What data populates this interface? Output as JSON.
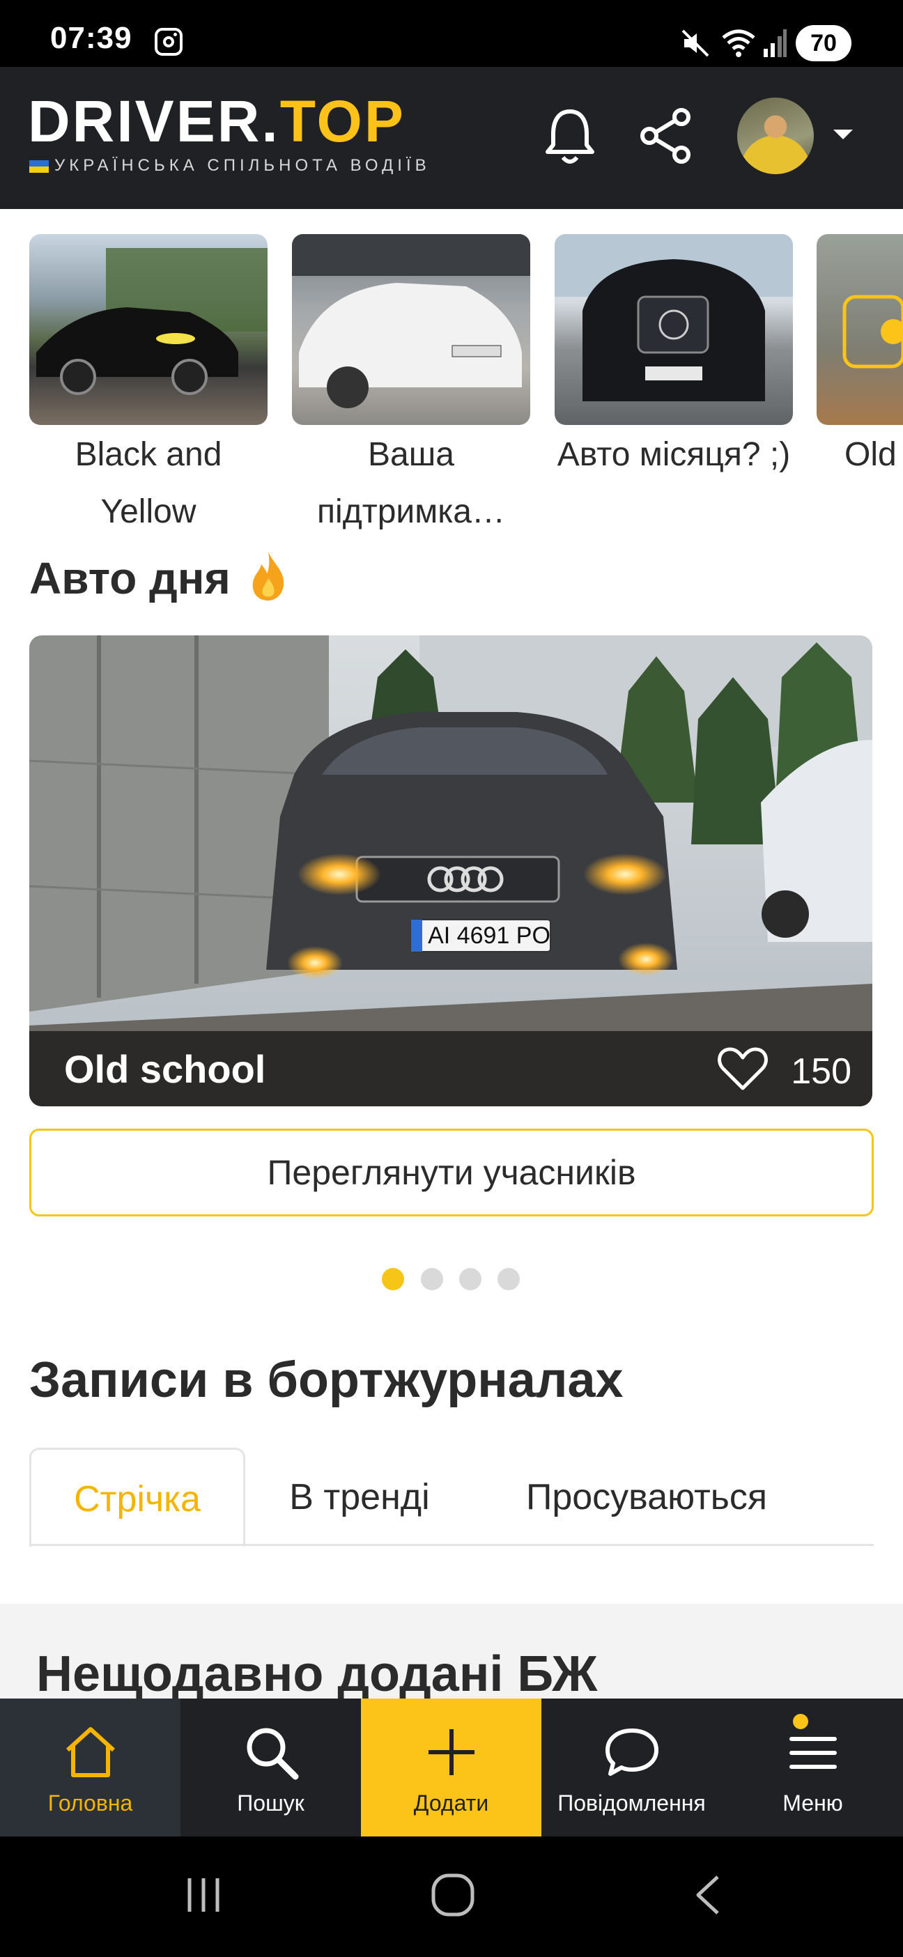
{
  "status_bar": {
    "time": "07:39",
    "battery": "70"
  },
  "header": {
    "logo_main": "DRIVER.",
    "logo_accent": "TOP",
    "tagline": "УКРАЇНСЬКА СПІЛЬНОТА ВОДІЇВ",
    "icons": [
      "bell-icon",
      "share-icon",
      "avatar",
      "chevron-down-icon"
    ]
  },
  "stories": [
    {
      "label": "Black and Yellow"
    },
    {
      "label": "Ваша підтримка…"
    },
    {
      "label": "Авто місяця? ;)"
    },
    {
      "label": "Old"
    }
  ],
  "car_of_day": {
    "title": "Авто дня",
    "car_name": "Old school",
    "likes": "150",
    "plate": "AI 4691 PO",
    "view_button": "Переглянути учасників",
    "pagination": {
      "total": 4,
      "active": 1
    }
  },
  "logbooks": {
    "title": "Записи в бортжурналах",
    "tabs": [
      {
        "label": "Стрічка",
        "active": true
      },
      {
        "label": "В тренді",
        "active": false
      },
      {
        "label": "Просуваються",
        "active": false
      }
    ]
  },
  "recent": {
    "title": "Нещодавно додані БЖ"
  },
  "bottom_nav": {
    "items": [
      {
        "label": "Головна",
        "icon": "home-icon"
      },
      {
        "label": "Пошук",
        "icon": "search-icon"
      },
      {
        "label": "Додати",
        "icon": "plus-icon"
      },
      {
        "label": "Повідомлення",
        "icon": "chat-icon"
      },
      {
        "label": "Меню",
        "icon": "menu-icon"
      }
    ]
  },
  "colors": {
    "accent": "#fcc419",
    "dark": "#1f2124"
  }
}
